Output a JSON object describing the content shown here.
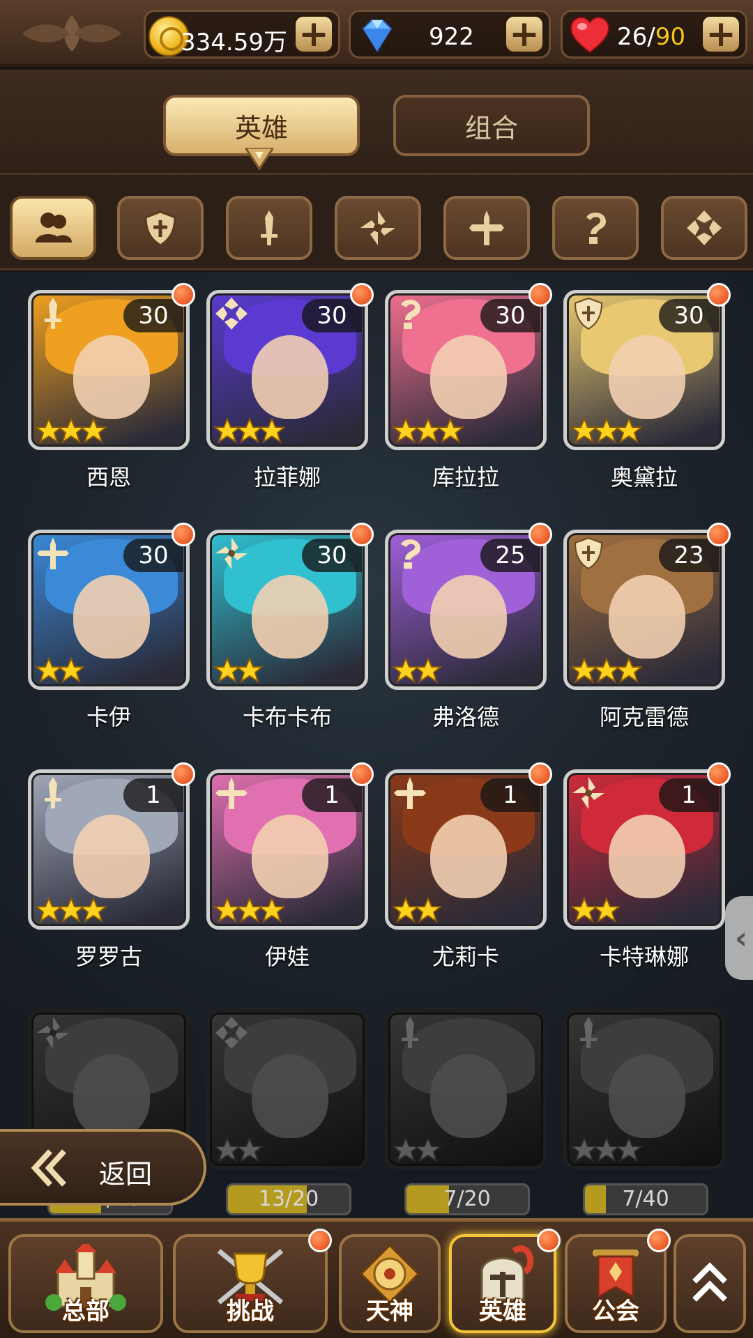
{
  "resources": {
    "gold": "334.59万",
    "diamonds": "922",
    "stamina_current": "26",
    "stamina_separator": "/",
    "stamina_max": "90",
    "plus_label": "+"
  },
  "tabs": [
    {
      "label": "英雄",
      "active": true
    },
    {
      "label": "组合",
      "active": false
    }
  ],
  "filters": [
    {
      "icon": "all-heroes-icon",
      "active": true
    },
    {
      "icon": "shield-class-icon"
    },
    {
      "icon": "sword-class-icon"
    },
    {
      "icon": "shuriken-class-icon"
    },
    {
      "icon": "cross-class-icon"
    },
    {
      "icon": "mystic-class-icon"
    },
    {
      "icon": "support-class-icon"
    }
  ],
  "heroes": [
    {
      "name": "西恩",
      "level": "30",
      "stars": 3,
      "class": "sword-class-icon",
      "hair": "#f0a020"
    },
    {
      "name": "拉菲娜",
      "level": "30",
      "stars": 3,
      "class": "support-class-icon",
      "hair": "#5a3ad0"
    },
    {
      "name": "库拉拉",
      "level": "30",
      "stars": 3,
      "class": "mystic-class-icon",
      "hair": "#f07090"
    },
    {
      "name": "奥黛拉",
      "level": "30",
      "stars": 3,
      "class": "shield-class-icon",
      "hair": "#e8c870"
    },
    {
      "name": "卡伊",
      "level": "30",
      "stars": 2,
      "class": "cross-class-icon",
      "hair": "#3a8ad8"
    },
    {
      "name": "卡布卡布",
      "level": "30",
      "stars": 2,
      "class": "shuriken-class-icon",
      "hair": "#30c0d0"
    },
    {
      "name": "弗洛德",
      "level": "25",
      "stars": 2,
      "class": "mystic-class-icon",
      "hair": "#a060d8"
    },
    {
      "name": "阿克雷德",
      "level": "23",
      "stars": 3,
      "class": "shield-class-icon",
      "hair": "#a07040"
    },
    {
      "name": "罗罗古",
      "level": "1",
      "stars": 3,
      "class": "sword-class-icon",
      "hair": "#a0a8b8"
    },
    {
      "name": "伊娃",
      "level": "1",
      "stars": 3,
      "class": "cross-class-icon",
      "hair": "#e070b0"
    },
    {
      "name": "尤莉卡",
      "level": "1",
      "stars": 2,
      "class": "cross-class-icon",
      "hair": "#8a3a18"
    },
    {
      "name": "卡特琳娜",
      "level": "1",
      "stars": 2,
      "class": "shuriken-class-icon",
      "hair": "#d02a3a"
    }
  ],
  "locked_heroes": [
    {
      "progress": "17/40",
      "fraction": 0.425,
      "class": "shuriken-class-icon",
      "stars": 2
    },
    {
      "progress": "13/20",
      "fraction": 0.65,
      "class": "support-class-icon",
      "stars": 2
    },
    {
      "progress": "7/20",
      "fraction": 0.35,
      "class": "sword-class-icon",
      "stars": 2
    },
    {
      "progress": "7/40",
      "fraction": 0.175,
      "class": "sword-class-icon",
      "stars": 3
    }
  ],
  "back_label": "返回",
  "bottom_nav": [
    {
      "label": "总部"
    },
    {
      "label": "挑战"
    },
    {
      "label": "天神"
    },
    {
      "label": "英雄"
    },
    {
      "label": "公会"
    }
  ],
  "colors": {
    "gold_text": "#f5c518",
    "notification": "#e2400e",
    "active_tab": "#d7b06c"
  }
}
